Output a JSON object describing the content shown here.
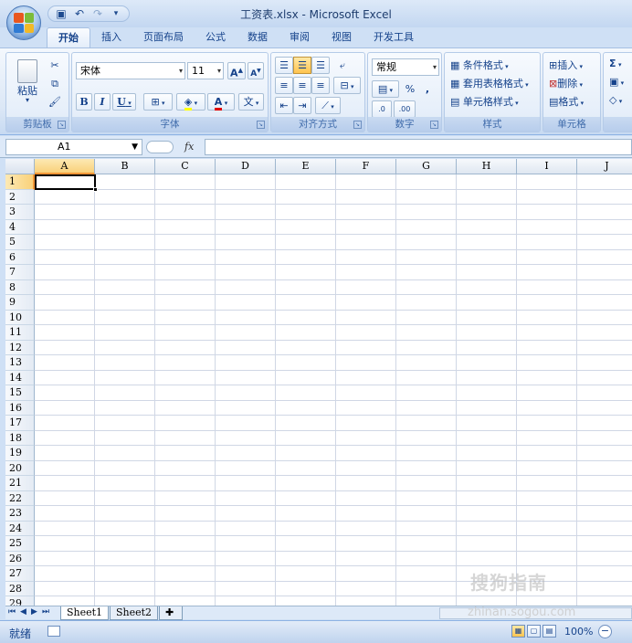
{
  "window": {
    "title": "工资表.xlsx - Microsoft Excel"
  },
  "qat": {
    "save_icon": "save-icon",
    "undo_icon": "undo-icon",
    "redo_icon": "redo-icon"
  },
  "tabs": [
    {
      "label": "开始",
      "active": true
    },
    {
      "label": "插入"
    },
    {
      "label": "页面布局"
    },
    {
      "label": "公式"
    },
    {
      "label": "数据"
    },
    {
      "label": "审阅"
    },
    {
      "label": "视图"
    },
    {
      "label": "开发工具"
    }
  ],
  "ribbon": {
    "clipboard": {
      "label": "剪贴板",
      "paste": "粘贴"
    },
    "font": {
      "label": "字体",
      "font_name": "宋体",
      "font_size": "11",
      "bold": "B",
      "italic": "I",
      "underline": "U",
      "grow": "A",
      "shrink": "A",
      "font_color_letter": "A",
      "phonetic": "文"
    },
    "alignment": {
      "label": "对齐方式"
    },
    "number": {
      "label": "数字",
      "format": "常规",
      "percent": "%",
      "comma": ",",
      "inc_decimal": ".0",
      "dec_decimal": ".00"
    },
    "styles": {
      "label": "样式",
      "conditional": "条件格式",
      "table": "套用表格格式",
      "cell_styles": "单元格样式"
    },
    "cells": {
      "label": "单元格",
      "insert": "插入",
      "delete": "删除",
      "format": "格式"
    },
    "editing": {
      "sum": "Σ"
    }
  },
  "formula_bar": {
    "name_box": "A1",
    "fx": "fx",
    "value": ""
  },
  "grid": {
    "columns": [
      "A",
      "B",
      "C",
      "D",
      "E",
      "F",
      "G",
      "H",
      "I",
      "J"
    ],
    "rows": [
      "1",
      "2",
      "3",
      "4",
      "5",
      "6",
      "7",
      "8",
      "9",
      "10",
      "11",
      "12",
      "13",
      "14",
      "15",
      "16",
      "17",
      "18",
      "19",
      "20",
      "21",
      "22",
      "23",
      "24",
      "25",
      "26",
      "27",
      "28",
      "29"
    ],
    "active_cell": "A1"
  },
  "sheets": [
    {
      "label": "Sheet1",
      "active": true
    },
    {
      "label": "Sheet2"
    }
  ],
  "status": {
    "ready": "就绪",
    "zoom": "100%"
  },
  "watermark": {
    "main": "搜狗指南",
    "url": "zhinan.sogou.com"
  }
}
